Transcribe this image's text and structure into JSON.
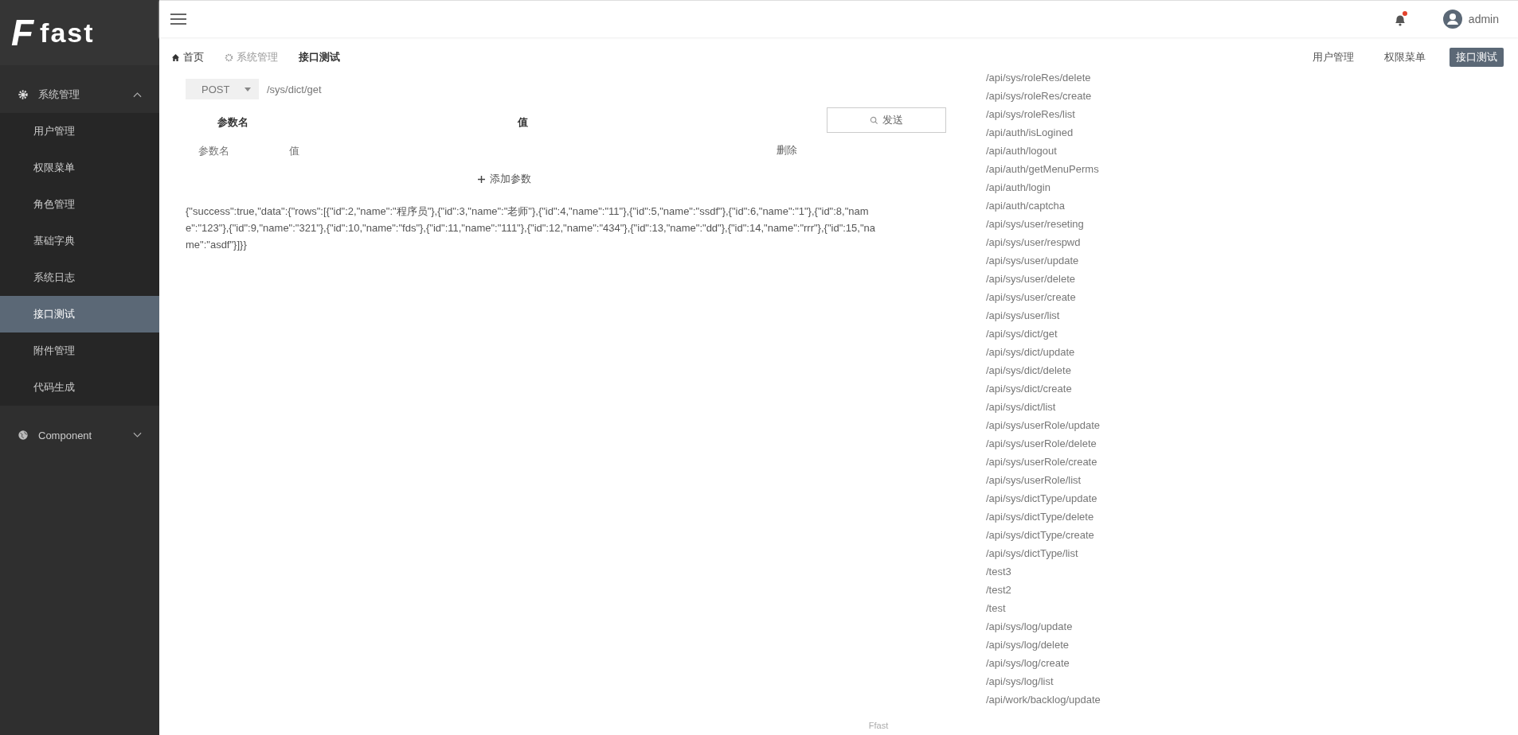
{
  "logo": {
    "mark": "F",
    "text": "fast"
  },
  "sidebar": {
    "groups": [
      {
        "label": "系统管理",
        "expanded": true,
        "items": [
          {
            "label": "用户管理",
            "selected": false
          },
          {
            "label": "权限菜单",
            "selected": false
          },
          {
            "label": "角色管理",
            "selected": false
          },
          {
            "label": "基础字典",
            "selected": false
          },
          {
            "label": "系统日志",
            "selected": false
          },
          {
            "label": "接口测试",
            "selected": true
          },
          {
            "label": "附件管理",
            "selected": false
          },
          {
            "label": "代码生成",
            "selected": false
          }
        ]
      },
      {
        "label": "Component",
        "expanded": false
      }
    ]
  },
  "header": {
    "user": "admin",
    "notification": true
  },
  "breadcrumb": [
    {
      "label": "首页",
      "current": false
    },
    {
      "label": "系统管理",
      "current": false
    },
    {
      "label": "接口测试",
      "current": true
    }
  ],
  "open_tabs": [
    {
      "label": "用户管理",
      "selected": false
    },
    {
      "label": "权限菜单",
      "selected": false
    },
    {
      "label": "接口测试",
      "selected": true
    }
  ],
  "request": {
    "method": "POST",
    "url": "/sys/dict/get"
  },
  "params": {
    "columns": [
      "参数名",
      "值"
    ],
    "rows": [
      {
        "name_placeholder": "参数名",
        "value_placeholder": "值",
        "delete": "删除"
      }
    ],
    "add": "添加参数"
  },
  "send_button": "发送",
  "response": "{\"success\":true,\"data\":{\"rows\":[{\"id\":2,\"name\":\"程序员\"},{\"id\":3,\"name\":\"老师\"},{\"id\":4,\"name\":\"11\"},{\"id\":5,\"name\":\"ssdf\"},{\"id\":6,\"name\":\"1\"},{\"id\":8,\"name\":\"123\"},{\"id\":9,\"name\":\"321\"},{\"id\":10,\"name\":\"fds\"},{\"id\":11,\"name\":\"111\"},{\"id\":12,\"name\":\"434\"},{\"id\":13,\"name\":\"dd\"},{\"id\":14,\"name\":\"rrr\"},{\"id\":15,\"name\":\"asdf\"}]}}",
  "url_suggestions": [
    "/api/sys/roleRes/delete",
    "/api/sys/roleRes/create",
    "/api/sys/roleRes/list",
    "/api/auth/isLogined",
    "/api/auth/logout",
    "/api/auth/getMenuPerms",
    "/api/auth/login",
    "/api/auth/captcha",
    "/api/sys/user/reseting",
    "/api/sys/user/respwd",
    "/api/sys/user/update",
    "/api/sys/user/delete",
    "/api/sys/user/create",
    "/api/sys/user/list",
    "/api/sys/dict/get",
    "/api/sys/dict/update",
    "/api/sys/dict/delete",
    "/api/sys/dict/create",
    "/api/sys/dict/list",
    "/api/sys/userRole/update",
    "/api/sys/userRole/delete",
    "/api/sys/userRole/create",
    "/api/sys/userRole/list",
    "/api/sys/dictType/update",
    "/api/sys/dictType/delete",
    "/api/sys/dictType/create",
    "/api/sys/dictType/list",
    "/test3",
    "/test2",
    "/test",
    "/api/sys/log/update",
    "/api/sys/log/delete",
    "/api/sys/log/create",
    "/api/sys/log/list",
    "/api/work/backlog/update"
  ],
  "footer": "Ffast"
}
